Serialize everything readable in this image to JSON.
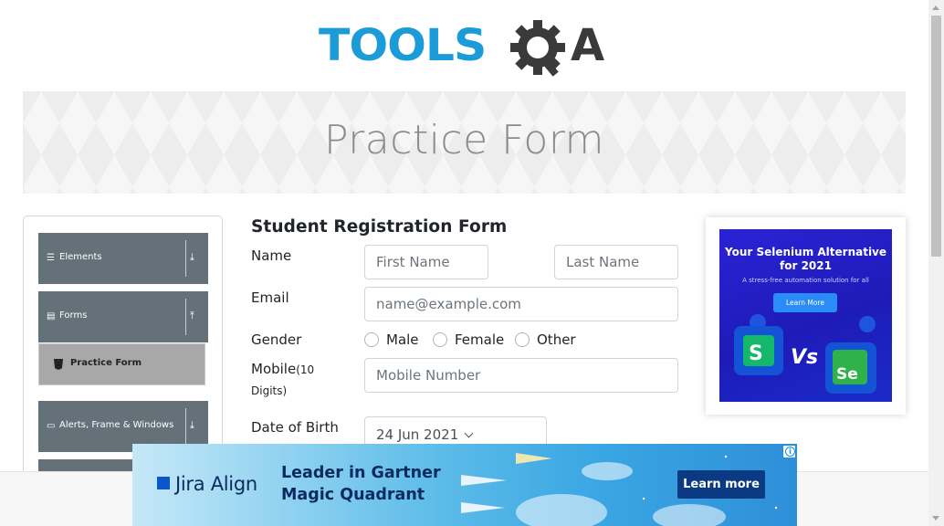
{
  "logo": {
    "text_left": "TOOLS",
    "text_right": "A",
    "alt": "ToolsQA"
  },
  "banner": {
    "title": "Practice Form"
  },
  "sidebar": {
    "groups": [
      {
        "label": "Elements",
        "icon": "menu-icon",
        "arrow": "download-arrow-icon"
      },
      {
        "label": "Forms",
        "icon": "document-icon",
        "arrow": "upload-arrow-icon"
      },
      {
        "label": "Alerts, Frame & Windows",
        "icon": "window-icon",
        "arrow": "download-arrow-icon"
      }
    ],
    "active_item": {
      "label": "Practice Form",
      "icon": "html5-icon"
    }
  },
  "form": {
    "heading": "Student Registration Form",
    "name_label": "Name",
    "first_name_placeholder": "First Name",
    "last_name_placeholder": "Last Name",
    "email_label": "Email",
    "email_placeholder": "name@example.com",
    "gender_label": "Gender",
    "gender_options": [
      "Male",
      "Female",
      "Other"
    ],
    "mobile_label": "Mobile",
    "mobile_hint_1": "(10",
    "mobile_hint_2": "Digits)",
    "mobile_placeholder": "Mobile Number",
    "dob_label": "Date of Birth",
    "dob_value": "24 Jun 2021"
  },
  "side_ad": {
    "title_line1": "Your Selenium Alternative",
    "title_line2": "for 2021",
    "subtitle": "A stress-free automation solution for all",
    "button_label": "Learn More",
    "vs_text": "Vs",
    "left_logo": "S",
    "right_logo": "Se",
    "colors": {
      "background": "#2a23d6",
      "button": "#2a8cf6"
    }
  },
  "bottom_ad": {
    "brand": "Jira Align",
    "headline_1": "Leader in Gartner",
    "headline_2": "Magic Quadrant",
    "button_label": "Learn more",
    "info_glyph": "i",
    "colors": {
      "text": "#0b2a5e",
      "button": "#0b3a82"
    }
  },
  "colors": {
    "sidebar_header": "#657179",
    "active_item": "#a8a8a8",
    "logo_blue": "#1b9bd8",
    "logo_dark": "#3a3a3a"
  }
}
